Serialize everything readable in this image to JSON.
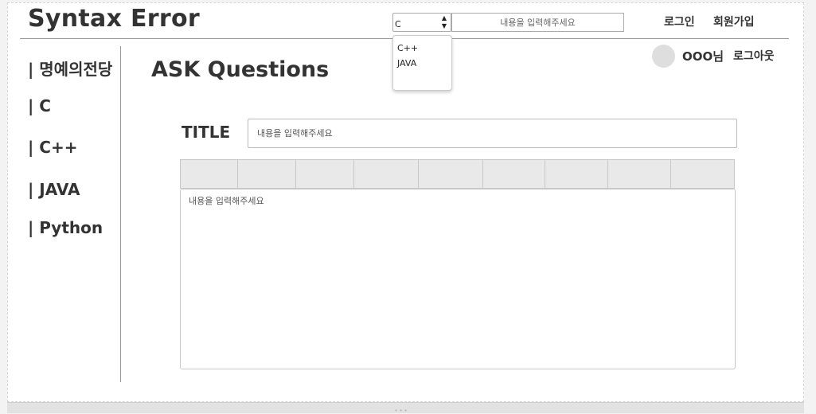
{
  "header": {
    "logo": "Syntax Error",
    "lang_select_value": "C",
    "search_placeholder": "내용을 입력해주세요",
    "login": "로그인",
    "signup": "회원가입"
  },
  "dropdown": {
    "options": [
      "C++",
      "JAVA"
    ]
  },
  "user": {
    "name": "OOO님",
    "logout": "로그아웃"
  },
  "sidebar": {
    "items": [
      {
        "label": "| 명예의전당"
      },
      {
        "label": "| C"
      },
      {
        "label": "| C++"
      },
      {
        "label": "| JAVA"
      },
      {
        "label": "| Python"
      }
    ]
  },
  "main": {
    "title": "ASK Questions",
    "title_label": "TITLE",
    "title_placeholder": "내용을 입력해주세요",
    "editor_placeholder": "내용을 입력해주세요"
  }
}
